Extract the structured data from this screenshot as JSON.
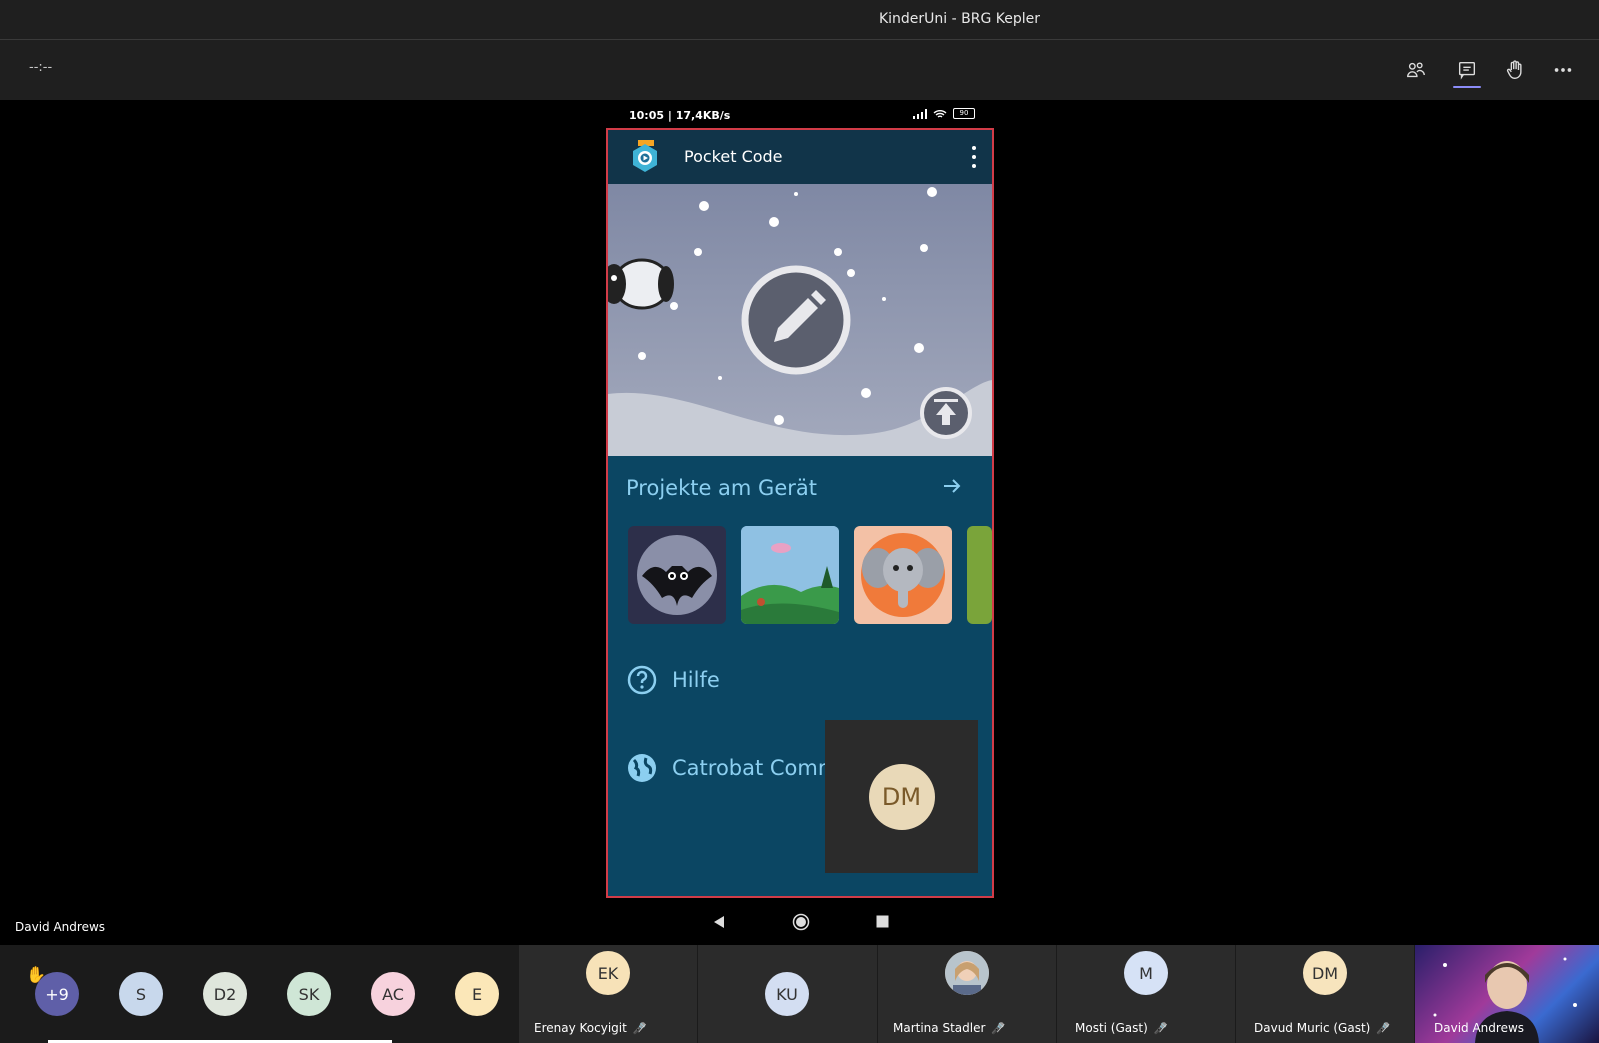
{
  "window": {
    "title": "KinderUni - BRG Kepler"
  },
  "toolbar": {
    "timer": "--:--"
  },
  "phone": {
    "status": {
      "left": "10:05 | 17,4KB/s",
      "battery": "90"
    },
    "app": {
      "title": "Pocket Code",
      "projects_title": "Projekte am Gerät",
      "help_label": "Hilfe",
      "community_label": "Catrobat Comm"
    }
  },
  "self_view": {
    "initials": "DM"
  },
  "presenter": {
    "name": "David Andrews"
  },
  "participants": {
    "overflow": "+9",
    "avatars": [
      {
        "initials": "S",
        "color": "#c8d8ec"
      },
      {
        "initials": "D2",
        "color": "#dfe6dc"
      },
      {
        "initials": "SK",
        "color": "#cfe6d6"
      },
      {
        "initials": "AC",
        "color": "#f7d2dd"
      },
      {
        "initials": "E",
        "color": "#fbe7b8"
      }
    ],
    "tiles": [
      {
        "initials": "EK",
        "name": "Erenay Kocyigit",
        "color": "#f7e2b8"
      },
      {
        "initials": "KU",
        "name": "",
        "color": "#d3def2"
      },
      {
        "initials": "",
        "name": "Martina Stadler",
        "color": "#d8c0a8"
      },
      {
        "initials": "M",
        "name": "Mosti (Gast)",
        "color": "#d6e2f6"
      },
      {
        "initials": "DM",
        "name": "Davud Muric (Gast)",
        "color": "#f7e4bd"
      },
      {
        "initials": "",
        "name": "David Andrews",
        "color": "#6a3aa8"
      }
    ]
  },
  "colors": {
    "accent": "#8b8cf8",
    "app_bg": "#0b4663",
    "app_text": "#8ccff0",
    "frame_red": "#d23c48"
  }
}
